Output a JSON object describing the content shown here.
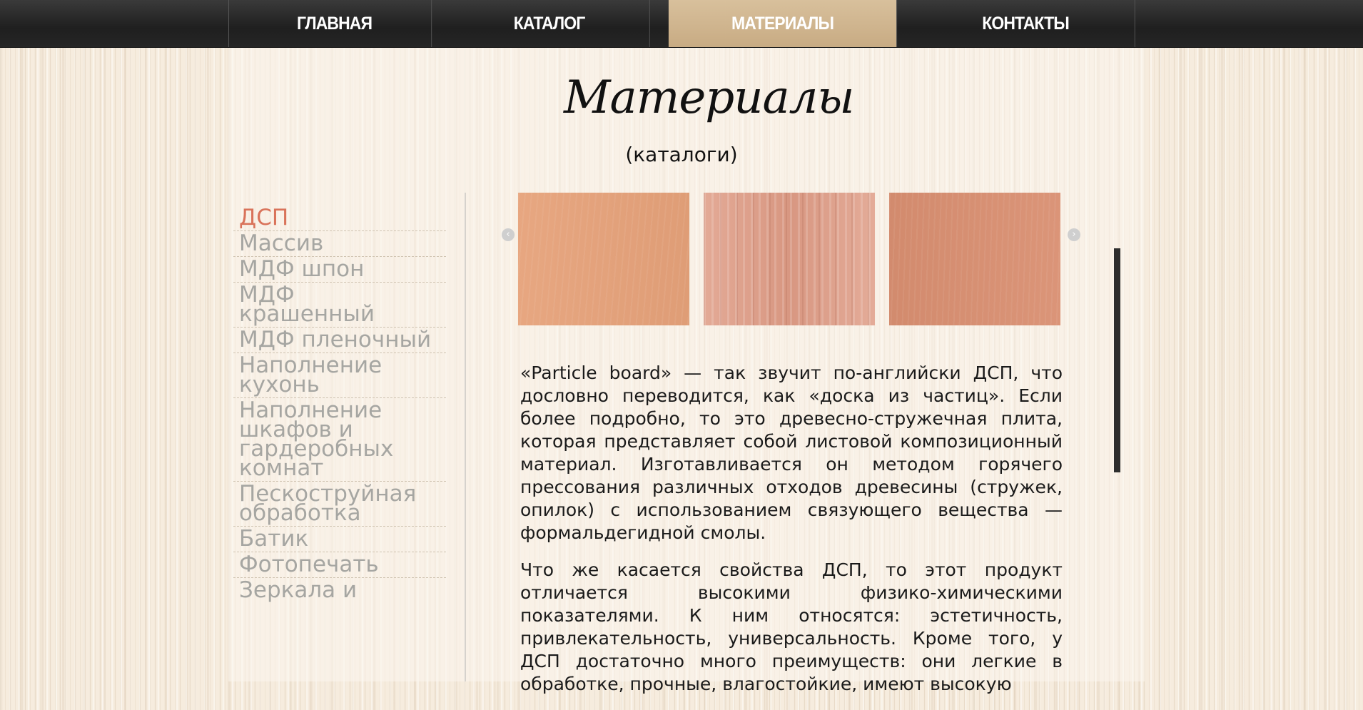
{
  "nav": {
    "items": [
      {
        "label": "ГЛАВНАЯ"
      },
      {
        "label": "КАТАЛОГ"
      },
      {
        "label": "МАТЕРИАЛЫ"
      },
      {
        "label": "КОНТАКТЫ"
      }
    ],
    "active": "МАТЕРИАЛЫ"
  },
  "header": {
    "title": "Материалы",
    "subtitle": "(каталоги)"
  },
  "sidebar": {
    "items": [
      {
        "label": "ДСП"
      },
      {
        "label": "Массив"
      },
      {
        "label": "МДФ шпон"
      },
      {
        "label": "МДФ крашенный"
      },
      {
        "label": "МДФ пленочный"
      },
      {
        "label": "Наполнение кухонь"
      },
      {
        "label": "Наполнение шкафов и гардеробных комнат"
      },
      {
        "label": "Пескоструйная обработка"
      },
      {
        "label": "Батик"
      },
      {
        "label": "Фотопечать"
      },
      {
        "label": "Зеркала и"
      }
    ],
    "active": "ДСП"
  },
  "gallery": {
    "swatch_colors": [
      "#e6a27a",
      "#e0a08a",
      "#d98f71"
    ],
    "prev_icon": "chevron-left-icon",
    "next_icon": "chevron-right-icon"
  },
  "article": {
    "paragraphs": [
      "«Particle board» — так звучит по-английски ДСП, что дословно переводится, как «доска из частиц». Если более подробно, то это древесно-стружечная плита, которая представляет собой листовой композиционный материал. Изготавливается он методом горячего прессования различных отходов древесины (стружек, опилок) с использованием связующего вещества — формальдегидной смолы.",
      "Что же касается свойства ДСП, то этот продукт отличается высокими физико-химическими показателями. К ним относятся: эстетичность, привлекательность, универсальность. Кроме того, у ДСП достаточно много преимуществ: они легкие в обработке, прочные, влагостойкие, имеют высокую"
    ]
  },
  "colors": {
    "nav_bg": "#262626",
    "nav_active_bg": "#c8ab83",
    "sidebar_active": "#d9735a",
    "sidebar_text": "#a6a6a2",
    "scrollbar": "#2e2e2e"
  }
}
